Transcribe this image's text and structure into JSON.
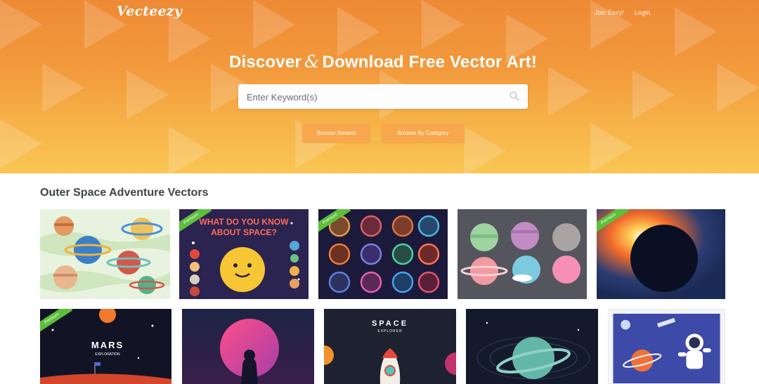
{
  "brand": {
    "logo_text": "Vecteezy"
  },
  "nav": {
    "join_label": "Join Eezy!",
    "login_label": "Login"
  },
  "hero": {
    "headline_part1": "Discover",
    "headline_amp": "&",
    "headline_part2": "Download Free Vector Art!",
    "search_placeholder": "Enter Keyword(s)",
    "search_value": "",
    "browse_newest_label": "Browse Newest",
    "browse_category_label": "Browse By Category"
  },
  "section": {
    "title": "Outer Space Adventure Vectors"
  },
  "thumbnails": {
    "premium_label": "Premium",
    "t2_line1": "WHAT DO YOU KNOW",
    "t2_line2": "ABOUT SPACE?",
    "t6_title": "MARS",
    "t6_subtitle": "EXPLORATION",
    "t8_title": "SPACE",
    "t8_subtitle": "EXPLORER"
  },
  "colors": {
    "hero_top": "#ee8a35",
    "hero_bottom": "#f9c653",
    "button": "#f7a84c",
    "premium_ribbon": "#5cbf3a"
  },
  "icons": {
    "search": "search-icon"
  }
}
